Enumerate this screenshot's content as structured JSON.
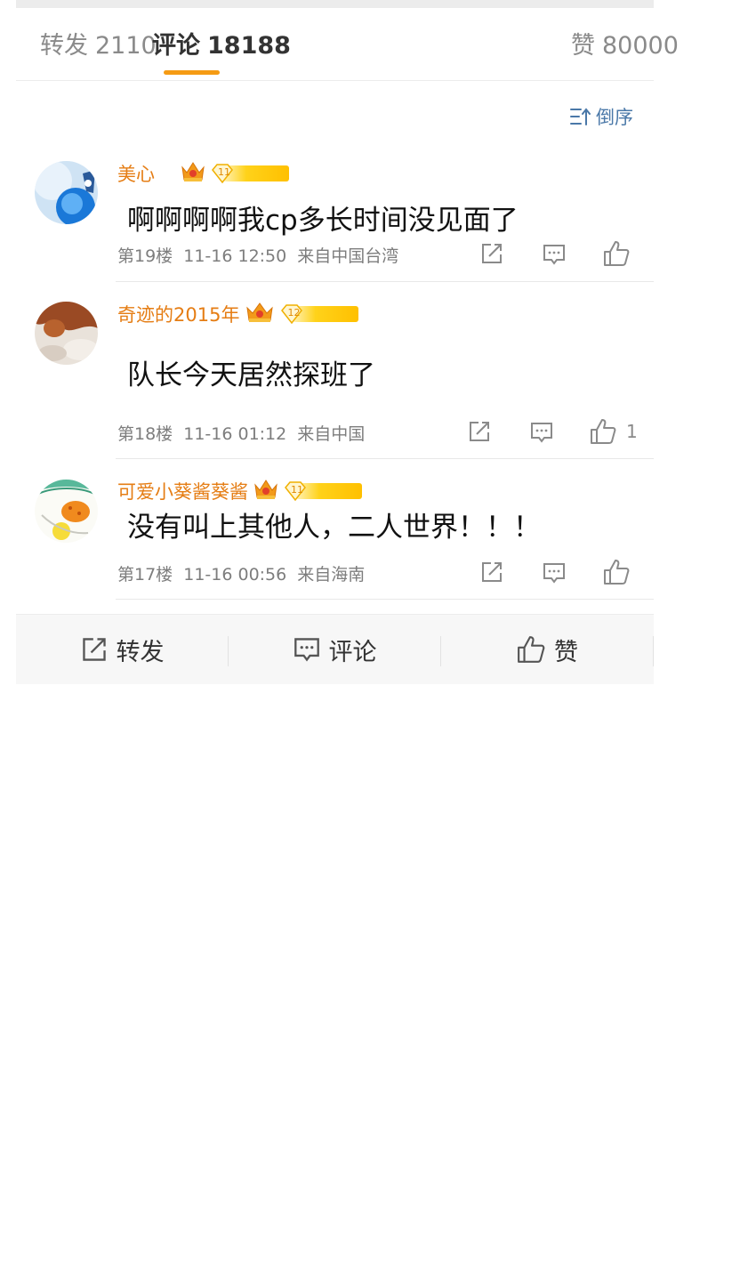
{
  "tabs": {
    "repost_label": "转发",
    "repost_count": "2110",
    "comment_label": "评论",
    "comment_count": "18188",
    "like_label": "赞",
    "like_count": "80000",
    "active": "comment",
    "accent_color": "#f59b14"
  },
  "sort": {
    "label": "倒序",
    "icon": "sort-icon"
  },
  "comments": [
    {
      "username": "美心",
      "level": "11",
      "content": "啊啊啊啊我cp多长时间没见面了",
      "floor": "第19楼",
      "time": "11-16 12:50",
      "location": "来自中国台湾",
      "likes": ""
    },
    {
      "username": "奇迹的2015年",
      "level": "12",
      "content": "队长今天居然探班了",
      "floor": "第18楼",
      "time": "11-16 01:12",
      "location": "来自中国",
      "likes": "1"
    },
    {
      "username": "可爱小葵酱葵酱",
      "level": "11",
      "content": "没有叫上其他人，二人世界！！！",
      "floor": "第17楼",
      "time": "11-16 00:56",
      "location": "来自海南",
      "likes": ""
    }
  ],
  "bottom_bar": {
    "repost_label": "转发",
    "comment_label": "评论",
    "like_label": "赞"
  },
  "colors": {
    "username": "#e57d14",
    "sort_link": "#4a78a8",
    "meta_text": "#7d7d7d"
  }
}
